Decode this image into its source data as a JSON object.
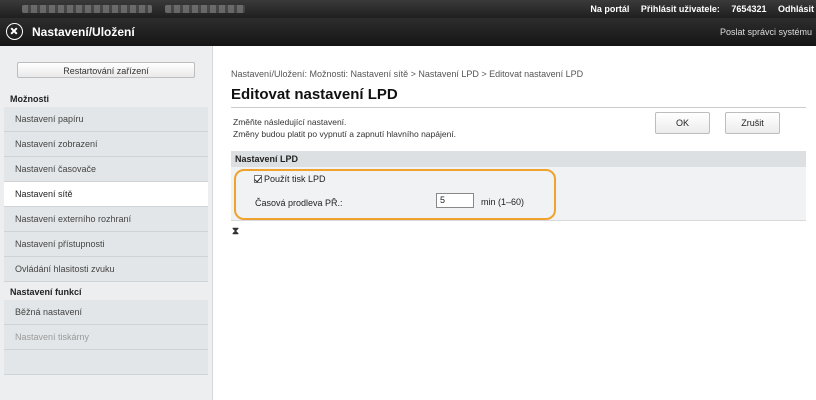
{
  "topbar": {
    "portal_link": "Na portál",
    "login_label": "Přihlásit uživatele:",
    "user_id": "7654321",
    "logout_link": "Odhlásit"
  },
  "header": {
    "title": "Nastavení/Uložení",
    "admin_mail_link": "Poslat správci systému"
  },
  "sidebar": {
    "restart_button": "Restartování zařízení",
    "section_options": "Možnosti",
    "items": [
      {
        "label": "Nastavení papíru"
      },
      {
        "label": "Nastavení zobrazení"
      },
      {
        "label": "Nastavení časovače"
      },
      {
        "label": "Nastavení sítě"
      },
      {
        "label": "Nastavení externího rozhraní"
      },
      {
        "label": "Nastavení přístupnosti"
      },
      {
        "label": "Ovládání hlasitosti zvuku"
      }
    ],
    "section_functions": "Nastavení funkcí",
    "function_items": [
      {
        "label": "Běžná nastavení"
      },
      {
        "label": "Nastavení tiskárny"
      }
    ],
    "active_item": "Nastavení sítě"
  },
  "main": {
    "breadcrumb": "Nastavení/Uložení: Možnosti: Nastavení sítě > Nastavení LPD > Editovat nastavení LPD",
    "page_title": "Editovat nastavení LPD",
    "instruction_1": "Změňte následující nastavení.",
    "instruction_2": "Změny budou platit po vypnutí a zapnutí hlavního napájení.",
    "ok_button": "OK",
    "cancel_button": "Zrušit",
    "section_title": "Nastavení LPD",
    "use_lpd_label": "Použít tisk LPD",
    "use_lpd_checked": true,
    "timeout_label": "Časová prodleva PŘ.:",
    "timeout_value": "5",
    "timeout_unit": "min (1–60)"
  },
  "colors": {
    "highlight": "#f0a22e",
    "header_bg": "#1f1f1f",
    "sidebar_bg": "#eceeef",
    "section_bar": "#dde0e2"
  }
}
